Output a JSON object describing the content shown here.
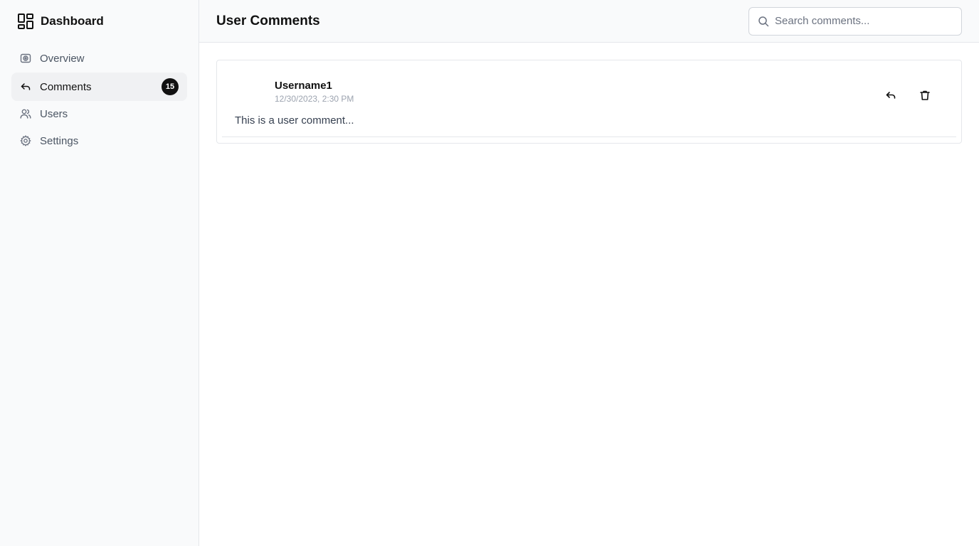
{
  "sidebar": {
    "brand": {
      "title": "Dashboard",
      "icon": "dashboard-grid-icon"
    },
    "items": [
      {
        "label": "Overview",
        "icon": "overview-icon",
        "active": false
      },
      {
        "label": "Comments",
        "icon": "reply-icon",
        "active": true,
        "badge": "15"
      },
      {
        "label": "Users",
        "icon": "users-icon",
        "active": false
      },
      {
        "label": "Settings",
        "icon": "gear-icon",
        "active": false
      }
    ]
  },
  "header": {
    "title": "User Comments",
    "search": {
      "placeholder": "Search comments...",
      "value": ""
    }
  },
  "comments": [
    {
      "username": "Username1",
      "timestamp": "12/30/2023, 2:30 PM",
      "text": "This is a user comment...",
      "actions": {
        "reply_icon": "reply-icon",
        "delete_icon": "trash-icon"
      }
    }
  ],
  "colors": {
    "sidebar_bg": "#f9fafb",
    "active_item_bg": "#f0f1f3",
    "badge_bg": "#111111",
    "border": "#e5e7eb",
    "muted_text": "#9ca3af"
  }
}
